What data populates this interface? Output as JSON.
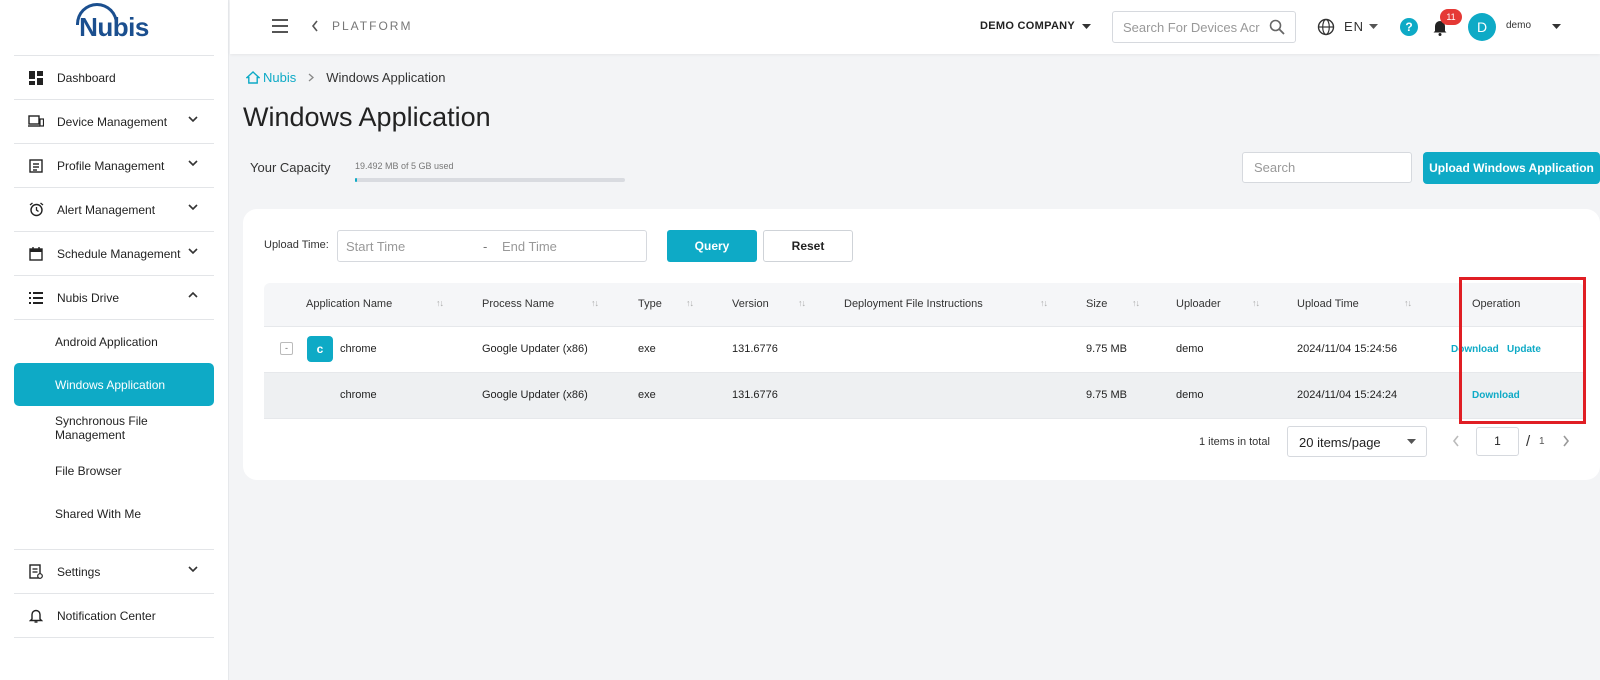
{
  "brand": {
    "name": "Nubis",
    "color": "#1b4f8f",
    "accent": "#0eaac6"
  },
  "sidebar": {
    "items": [
      {
        "label": "Dashboard",
        "icon": "dashboard-icon"
      },
      {
        "label": "Device Management",
        "icon": "devices-icon"
      },
      {
        "label": "Profile Management",
        "icon": "profile-icon"
      },
      {
        "label": "Alert Management",
        "icon": "alarm-icon"
      },
      {
        "label": "Schedule Management",
        "icon": "calendar-icon"
      },
      {
        "label": "Nubis Drive",
        "icon": "drive-icon"
      },
      {
        "label": "Settings",
        "icon": "settings-icon"
      },
      {
        "label": "Notification Center",
        "icon": "bell-icon"
      }
    ],
    "drive_sub": [
      {
        "label": "Android Application"
      },
      {
        "label": "Windows Application"
      },
      {
        "label": "Synchronous File Management"
      },
      {
        "label": "File Browser"
      },
      {
        "label": "Shared With Me"
      }
    ]
  },
  "header": {
    "platform": "PLATFORM",
    "company": "DEMO COMPANY",
    "search_placeholder": "Search For Devices Acr",
    "language": "EN",
    "help": "?",
    "notifications": "11",
    "avatar_letter": "D",
    "username": "demo"
  },
  "breadcrumb": {
    "home": "Nubis",
    "current": "Windows Application"
  },
  "page": {
    "title": "Windows Application",
    "capacity_label": "Your Capacity",
    "capacity_text": "19.492 MB of 5 GB used",
    "capacity_fraction": 0.004,
    "search_placeholder": "Search",
    "upload_label": "Upload Windows Application"
  },
  "filter": {
    "label": "Upload Time:",
    "start_placeholder": "Start Time",
    "separator": "-",
    "end_placeholder": "End Time",
    "query": "Query",
    "reset": "Reset"
  },
  "table": {
    "columns": [
      "Application Name",
      "Process Name",
      "Type",
      "Version",
      "Deployment File Instructions",
      "Size",
      "Uploader",
      "Upload Time",
      "Operation"
    ],
    "rows": [
      {
        "expander": "-",
        "icon_letter": "c",
        "name": "chrome",
        "process": "Google Updater (x86)",
        "type": "exe",
        "version": "131.6776",
        "instructions": "",
        "size": "9.75 MB",
        "uploader": "demo",
        "time": "2024/11/04 15:24:56",
        "op1": "Download",
        "op2": "Update"
      },
      {
        "name": "chrome",
        "process": "Google Updater (x86)",
        "type": "exe",
        "version": "131.6776",
        "instructions": "",
        "size": "9.75 MB",
        "uploader": "demo",
        "time": "2024/11/04 15:24:24",
        "op1": "Download"
      }
    ]
  },
  "pagination": {
    "total": "1 items in total",
    "per_page": "20 items/page",
    "current": "1",
    "slash": "/",
    "pages": "1"
  }
}
